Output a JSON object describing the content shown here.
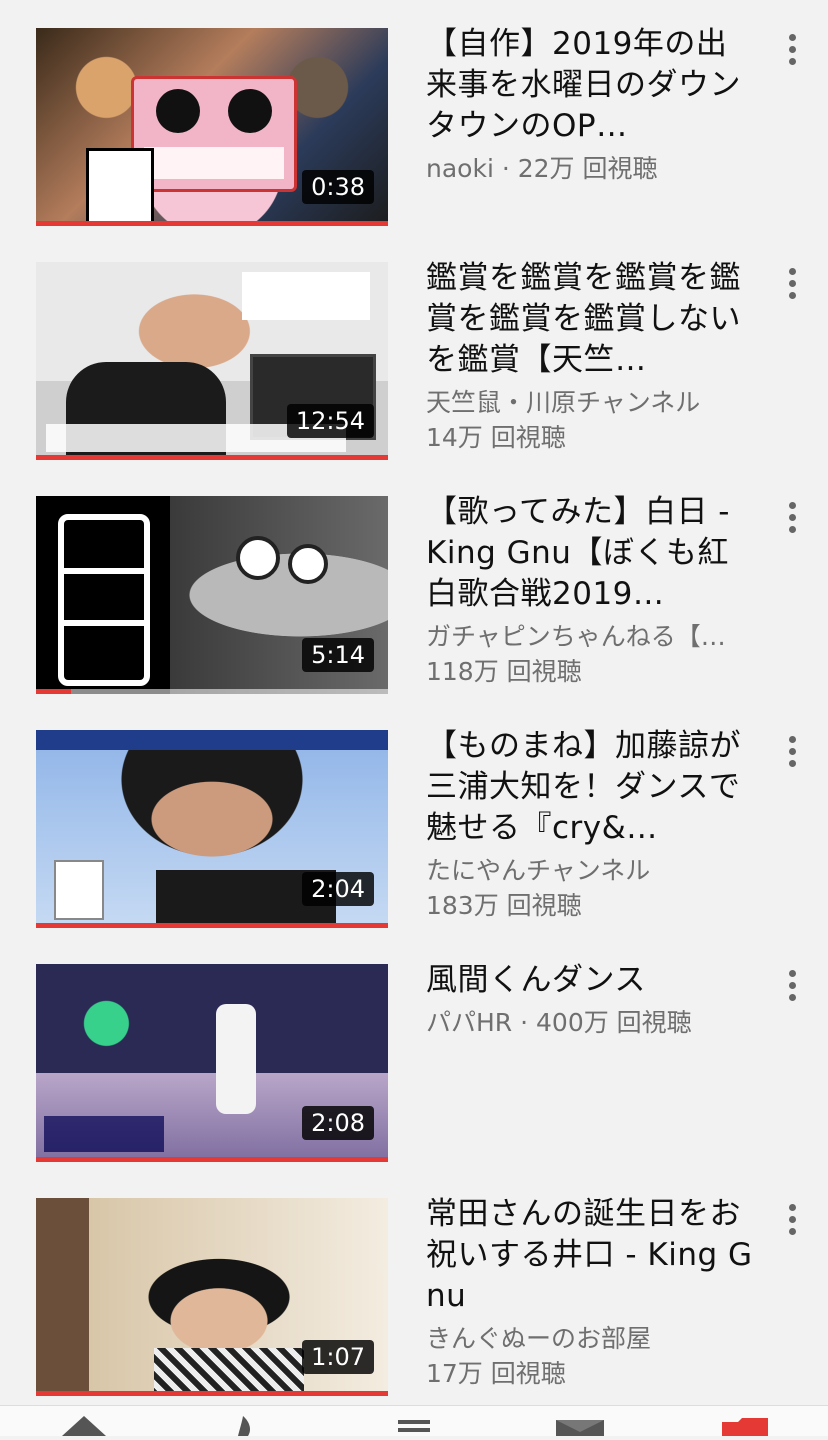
{
  "colors": {
    "accent": "#e53935",
    "background": "#f2f2f2",
    "title": "#111111",
    "meta": "#6f6f6f"
  },
  "videos": [
    {
      "title": "【自作】2019年の出来事を水曜日のダウンタウンのOP…",
      "meta1": "naoki · 22万 回視聴",
      "meta2": "",
      "duration": "0:38",
      "watched": 1.0,
      "thumb_theme": "reiwa-collage"
    },
    {
      "title": "鑑賞を鑑賞を鑑賞を鑑賞を鑑賞を鑑賞しないを鑑賞【天竺…",
      "meta1": "天竺鼠・川原チャンネル",
      "meta2": "14万 回視聴",
      "duration": "12:54",
      "watched": 1.0,
      "thumb_theme": "office-man"
    },
    {
      "title": "【歌ってみた】白日 - King Gnu【ぼくも紅白歌合戦2019…",
      "meta1": "ガチャピンちゃんねる【…",
      "meta2": "118万 回視聴",
      "duration": "5:14",
      "watched": 0.1,
      "thumb_theme": "mukku-bw"
    },
    {
      "title": "【ものまね】加藤諒が三浦大知を！ダンスで魅せる『cry&…",
      "meta1": "たにやんチャンネル",
      "meta2": "183万 回視聴",
      "duration": "2:04",
      "watched": 1.0,
      "thumb_theme": "singer-stage"
    },
    {
      "title": "風間くんダンス",
      "meta1": "パパHR · 400万 回視聴",
      "meta2": "",
      "duration": "2:08",
      "watched": 1.0,
      "thumb_theme": "bar-dance"
    },
    {
      "title": "常田さんの誕生日をお祝いする井口 - King Gnu",
      "meta1": "きんぐぬーのお部屋",
      "meta2": "17万 回視聴",
      "duration": "1:07",
      "watched": 1.0,
      "thumb_theme": "glasses-room"
    }
  ],
  "bottom_nav": [
    "home-icon",
    "explore-icon",
    "subscriptions-icon",
    "inbox-icon",
    "library-icon"
  ]
}
